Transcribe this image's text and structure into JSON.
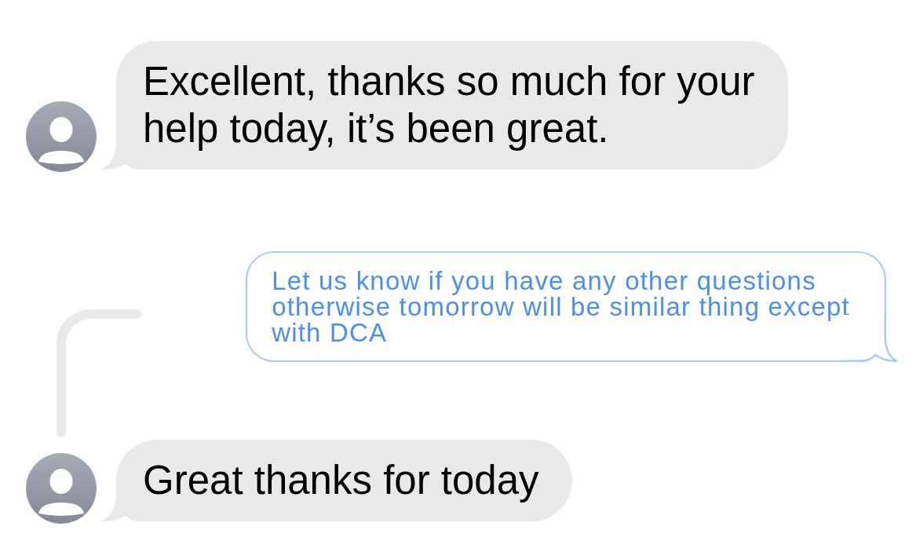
{
  "messages": [
    {
      "kind": "incoming",
      "lines": [
        "Excellent, thanks so much for your",
        "help today, it’s been great."
      ]
    },
    {
      "kind": "quoted",
      "reply_line": true,
      "lines": [
        "Let us know if you have any other questions",
        "otherwise tomorrow will be similar thing except",
        "with DCA"
      ]
    },
    {
      "kind": "incoming",
      "lines": [
        "Great thanks for today"
      ]
    }
  ]
}
